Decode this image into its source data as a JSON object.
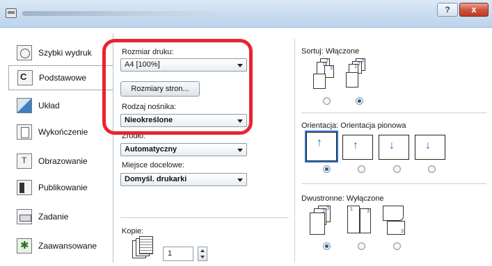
{
  "sidebar": {
    "items": [
      {
        "label": "Szybki wydruk",
        "icon": "quick-print-icon"
      },
      {
        "label": "Podstawowe",
        "icon": "basic-icon",
        "active": true
      },
      {
        "label": "Układ",
        "icon": "layout-icon"
      },
      {
        "label": "Wykończenie",
        "icon": "finishing-icon"
      },
      {
        "label": "Obrazowanie",
        "icon": "imaging-icon"
      },
      {
        "label": "Publikowanie",
        "icon": "publishing-icon"
      },
      {
        "label": "Zadanie",
        "icon": "job-icon"
      },
      {
        "label": "Zaawansowane",
        "icon": "advanced-icon"
      }
    ]
  },
  "titlebar": {
    "help": "?",
    "close": "x"
  },
  "main": {
    "print_size_label": "Rozmiar druku:",
    "print_size_value": "A4  [100%]",
    "page_sizes_button": "Rozmiary stron...",
    "media_type_label": "Rodzaj nośnika:",
    "media_type_value": "Nieokreślone",
    "source_label": "Źródło:",
    "source_value": "Automatyczny",
    "destination_label": "Miejsce docelowe:",
    "destination_value": "Domyśl. drukarki",
    "copies_label": "Kopie:",
    "copies_value": "1"
  },
  "right": {
    "collate_label": "Sortuj:",
    "collate_value": "Włączone",
    "orientation_label": "Orientacja:",
    "orientation_value": "Orientacja pionowa",
    "duplex_label": "Dwustronne:",
    "duplex_value": "Wyłączone",
    "collate_page_numbers": [
      "2",
      "1",
      "3",
      "2",
      "1",
      "3"
    ],
    "duplex_page_numbers": [
      "2",
      "3",
      "1",
      "3",
      "3"
    ]
  },
  "colors": {
    "highlight": "#e8242f",
    "accent": "#2d73c9"
  }
}
